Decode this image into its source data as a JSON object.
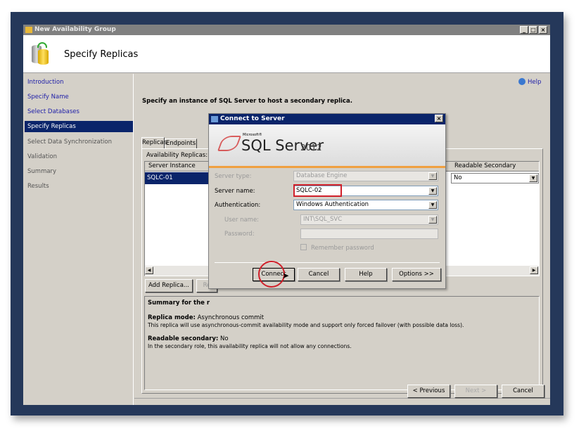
{
  "window": {
    "title": "New Availability Group",
    "page_title": "Specify Replicas",
    "minimize": "_",
    "maximize": "□",
    "close": "×"
  },
  "sidebar": {
    "items": [
      {
        "label": "Introduction",
        "state": "link"
      },
      {
        "label": "Specify Name",
        "state": "link"
      },
      {
        "label": "Select Databases",
        "state": "link"
      },
      {
        "label": "Specify Replicas",
        "state": "selected"
      },
      {
        "label": "Select Data Synchronization",
        "state": "disabled"
      },
      {
        "label": "Validation",
        "state": "disabled"
      },
      {
        "label": "Summary",
        "state": "disabled"
      },
      {
        "label": "Results",
        "state": "disabled"
      }
    ]
  },
  "main": {
    "help": "Help",
    "instruction": "Specify an instance of SQL Server to host a secondary replica.",
    "tabs": [
      "Replicas",
      "Endpoints"
    ],
    "replicas_label": "Availability Replicas:",
    "columns": {
      "server_instance": "Server Instance",
      "readable_secondary": "Readable Secondary"
    },
    "rows": [
      {
        "server_instance": "SQLC-01",
        "readable_secondary": "No"
      }
    ],
    "add_replica": "Add Replica...",
    "remove": "Re",
    "summary_title": "Summary for the r",
    "replica_mode_label": "Replica mode:",
    "replica_mode_value": "Asynchronous commit",
    "replica_mode_desc": "This replica will use asynchronous-commit availability mode and support only forced failover (with possible data loss).",
    "readable_label": "Readable secondary:",
    "readable_value": "No",
    "readable_desc": "In the secondary role, this availability replica will not allow any connections."
  },
  "footer": {
    "previous": "< Previous",
    "next": "Next >",
    "cancel": "Cancel"
  },
  "dialog": {
    "title": "Connect to Server",
    "brand_small": "Microsoft®",
    "brand": "SQL Server",
    "version": "2012",
    "server_type_label": "Server type:",
    "server_type": "Database Engine",
    "server_name_label": "Server name:",
    "server_name": "SQLC-02",
    "auth_label": "Authentication:",
    "auth": "Windows Authentication",
    "user_label": "User name:",
    "user": "INT\\SQL_SVC",
    "password_label": "Password:",
    "password": "",
    "remember": "Remember password",
    "connect": "Connect",
    "cancel": "Cancel",
    "help": "Help",
    "options": "Options >>",
    "close": "×"
  },
  "colors": {
    "selection": "#0a246a",
    "highlight": "#d0202a",
    "link": "#1c1ca8"
  }
}
